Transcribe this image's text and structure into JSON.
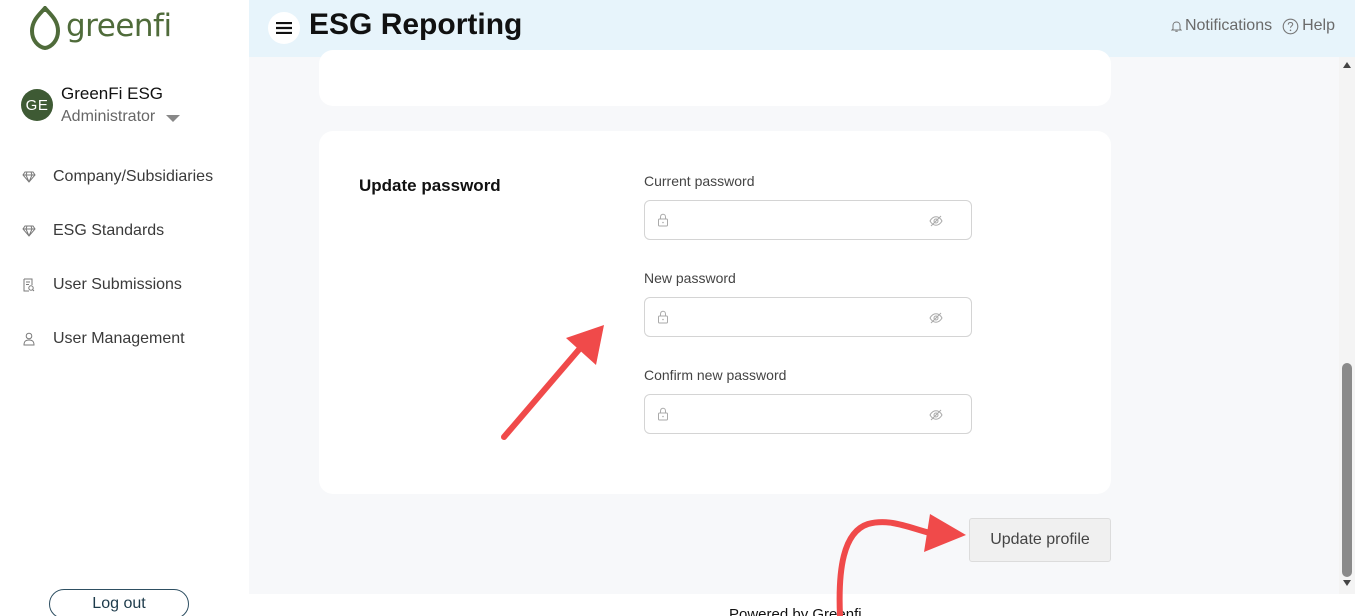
{
  "app": {
    "logo_text": "greenfi",
    "title": "ESG Reporting"
  },
  "header": {
    "notifications_label": "Notifications",
    "help_label": "Help"
  },
  "user": {
    "initials": "GE",
    "name": "GreenFi ESG",
    "role": "Administrator"
  },
  "sidebar": {
    "items": [
      {
        "label": "Company/Subsidiaries",
        "icon": "diamond-icon"
      },
      {
        "label": "ESG Standards",
        "icon": "diamond-icon"
      },
      {
        "label": "User Submissions",
        "icon": "document-search-icon"
      },
      {
        "label": "User Management",
        "icon": "user-icon"
      }
    ],
    "logout_label": "Log out"
  },
  "password_section": {
    "title": "Update password",
    "fields": [
      {
        "label": "Current password",
        "value": ""
      },
      {
        "label": "New password",
        "value": ""
      },
      {
        "label": "Confirm new password",
        "value": ""
      }
    ]
  },
  "update_button_label": "Update profile",
  "footer_text": "Powered by Greenfi",
  "colors": {
    "brand": "#4f6b3a",
    "header_bg": "#e7f4fb",
    "annotation": "#f04a4a"
  }
}
